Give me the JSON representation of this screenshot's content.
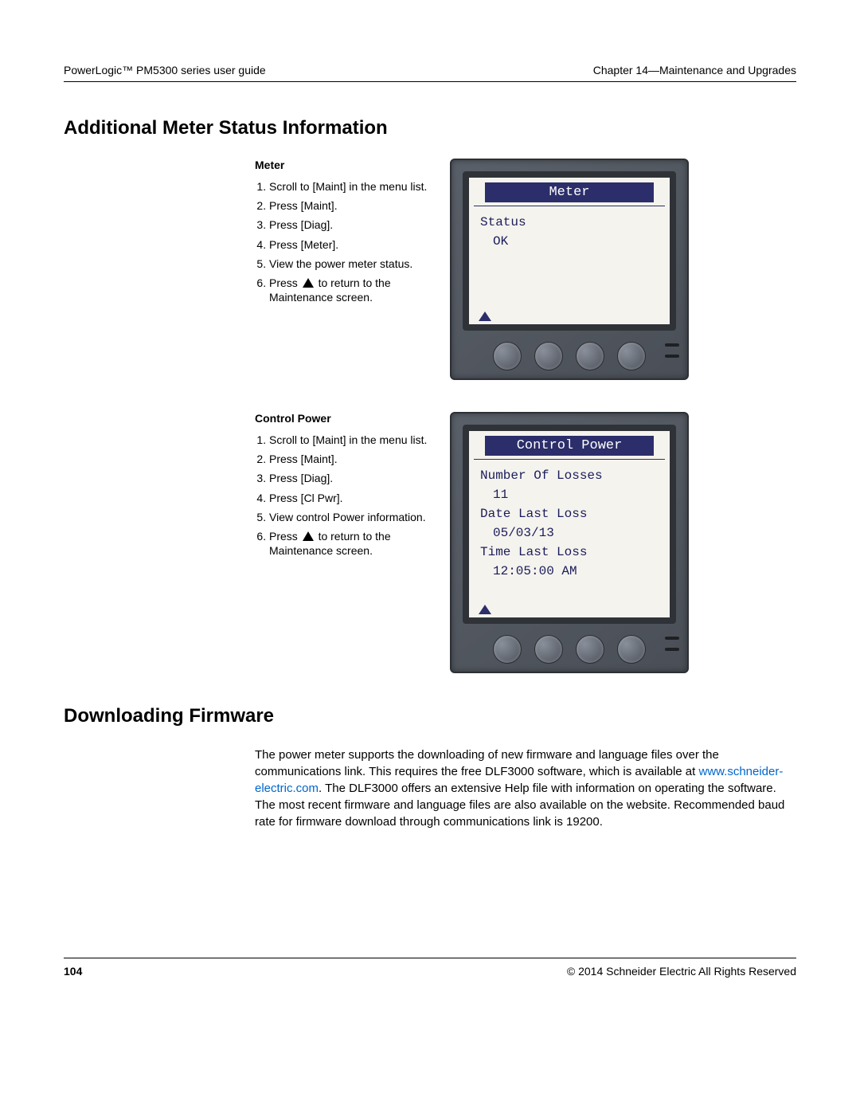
{
  "header": {
    "left": "PowerLogic™  PM5300 series user guide",
    "right": "Chapter 14—Maintenance and Upgrades"
  },
  "section1": {
    "title": "Additional Meter Status Information",
    "meter": {
      "subhead": "Meter",
      "steps": [
        "Scroll to [Maint] in the menu list.",
        "Press [Maint].",
        "Press [Diag].",
        "Press [Meter].",
        "View the power meter status.",
        "Press ▲ to return to the Maintenance screen."
      ],
      "step6_prefix": "Press ",
      "step6_suffix": " to return to the Maintenance screen.",
      "device": {
        "title": "Meter",
        "line1": "Status",
        "line2": "OK"
      }
    },
    "control_power": {
      "subhead": "Control Power",
      "steps": [
        "Scroll to [Maint] in the menu list.",
        "Press [Maint].",
        "Press [Diag].",
        "Press [Cl Pwr].",
        "View control Power information.",
        "Press ▲ to return to the Maintenance screen."
      ],
      "step6_prefix": "Press ",
      "step6_suffix": " to return to the Maintenance screen.",
      "device": {
        "title": "Control Power",
        "l1": "Number Of Losses",
        "v1": "11",
        "l2": "Date Last Loss",
        "v2": "05/03/13",
        "l3": "Time Last Loss",
        "v3": "12:05:00 AM"
      }
    }
  },
  "section2": {
    "title": "Downloading Firmware",
    "para_before_link": "The power meter supports the downloading of new firmware and language files over the communications link. This requires the free DLF3000 software, which is available at ",
    "link_text": "www.schneider-electric.com",
    "para_after_link": ". The DLF3000 offers an extensive Help file with information on operating the software. The most recent firmware and language files are also available on the website. Recommended baud rate for firmware download through communications link is 19200."
  },
  "footer": {
    "page": "104",
    "copyright": "© 2014 Schneider Electric All Rights Reserved"
  }
}
